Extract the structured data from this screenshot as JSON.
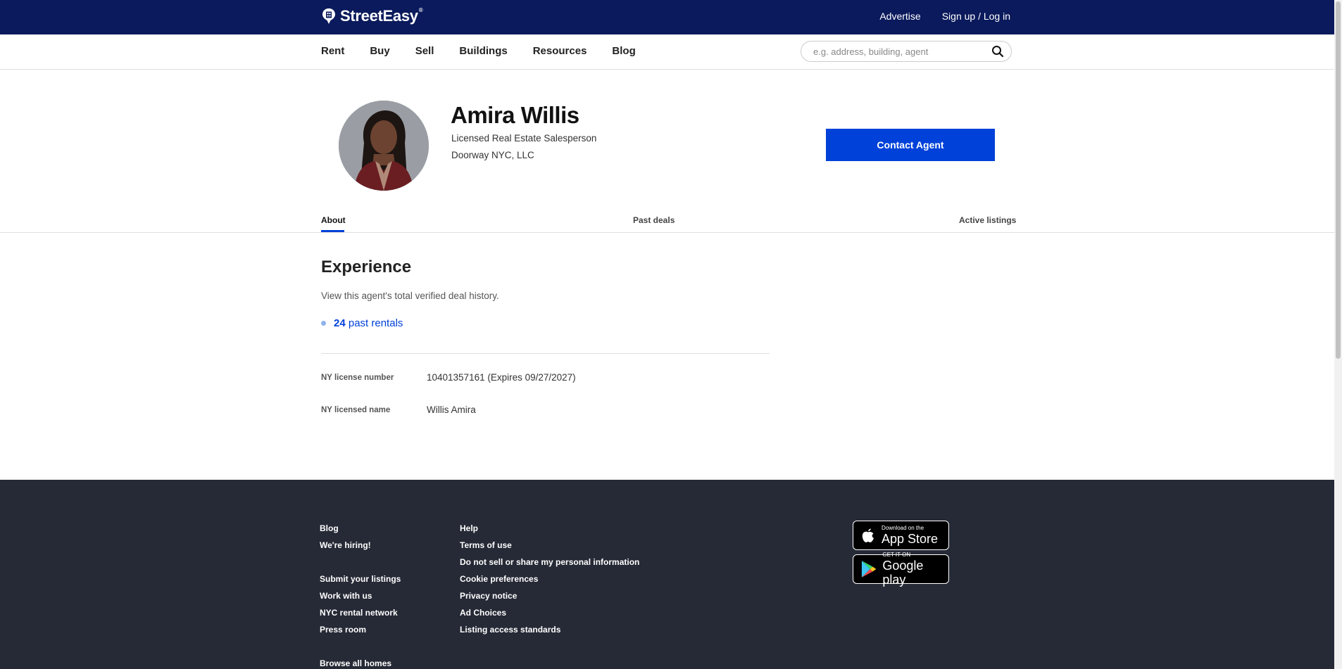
{
  "header": {
    "logo_text": "StreetEasy",
    "logo_reg": "®",
    "advertise": "Advertise",
    "signup": "Sign up / Log in"
  },
  "nav": {
    "items": [
      "Rent",
      "Buy",
      "Sell",
      "Buildings",
      "Resources",
      "Blog"
    ],
    "search_placeholder": "e.g. address, building, agent"
  },
  "agent": {
    "name": "Amira Willis",
    "title": "Licensed Real Estate Salesperson",
    "company": "Doorway NYC, LLC",
    "contact_label": "Contact Agent"
  },
  "tabs": [
    "About",
    "Past deals",
    "Active listings"
  ],
  "experience": {
    "heading": "Experience",
    "subtext": "View this agent's total verified deal history.",
    "rentals_count": "24",
    "rentals_label": " past rentals"
  },
  "license": {
    "number_label": "NY license number",
    "number_value": "10401357161 (Expires 09/27/2027)",
    "name_label": "NY licensed name",
    "name_value": "Willis Amira"
  },
  "footer": {
    "col1_group1": [
      "Blog",
      "We're hiring!"
    ],
    "col1_group2": [
      "Submit your listings",
      "Work with us",
      "NYC rental network",
      "Press room"
    ],
    "col1_group3": [
      "Browse all homes"
    ],
    "col2": [
      "Help",
      "Terms of use",
      "Do not sell or share my personal information",
      "Cookie preferences",
      "Privacy notice",
      "Ad Choices",
      "Listing access standards"
    ],
    "appstore_small": "Download on the",
    "appstore_big": "App Store",
    "googleplay_small": "GET IT ON",
    "googleplay_big": "Google play"
  },
  "colors": {
    "header_bg": "#0a1a5c",
    "accent": "#0041d9",
    "footer_bg": "#262a36"
  }
}
